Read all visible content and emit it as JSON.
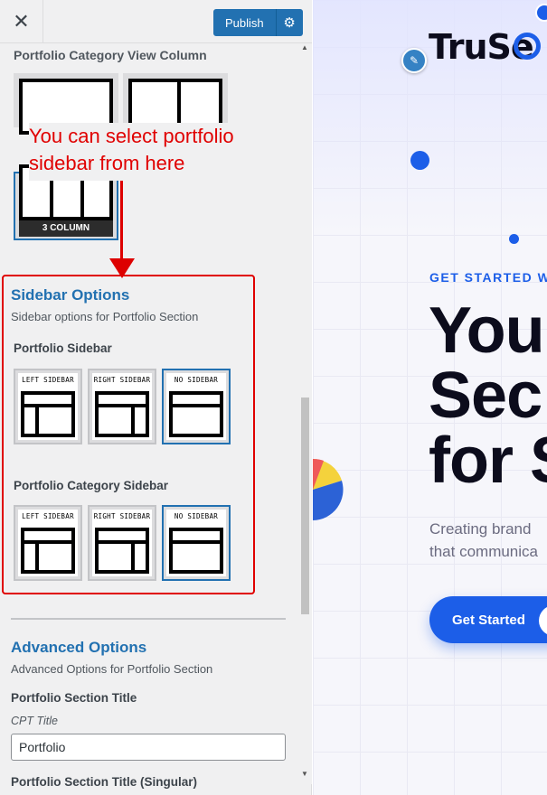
{
  "topbar": {
    "close_glyph": "✕",
    "publish_label": "Publish",
    "settings_glyph": "⚙"
  },
  "column_view": {
    "label": "Portfolio Category View Column",
    "selected_caption": "3 COLUMN"
  },
  "annotation": {
    "text": "You can select portfolio sidebar from here"
  },
  "sidebar_options": {
    "title": "Sidebar Options",
    "description": "Sidebar options for Portfolio Section",
    "portfolio_sidebar": {
      "label": "Portfolio Sidebar",
      "options": [
        "LEFT SIDEBAR",
        "RIGHT SIDEBAR",
        "NO SIDEBAR"
      ],
      "selected": "NO SIDEBAR"
    },
    "category_sidebar": {
      "label": "Portfolio Category Sidebar",
      "options": [
        "LEFT SIDEBAR",
        "RIGHT SIDEBAR",
        "NO SIDEBAR"
      ],
      "selected": "NO SIDEBAR"
    }
  },
  "advanced_options": {
    "title": "Advanced Options",
    "description": "Advanced Options for Portfolio Section",
    "section_title_label": "Portfolio Section Title",
    "cpt_title_label": "CPT Title",
    "cpt_title_value": "Portfolio",
    "singular_label": "Portfolio Section Title (Singular)"
  },
  "preview": {
    "brand": "TruSe",
    "edit_glyph": "✎",
    "eyebrow": "GET STARTED WI",
    "headline_lines": [
      "You",
      "Sec",
      "for S"
    ],
    "lead_lines": [
      "Creating brand",
      "that communica"
    ],
    "cta_label": "Get Started"
  },
  "colors": {
    "accent": "#2271b1",
    "annotation": "#e00000",
    "preview_brand": "#1c5ee8"
  }
}
